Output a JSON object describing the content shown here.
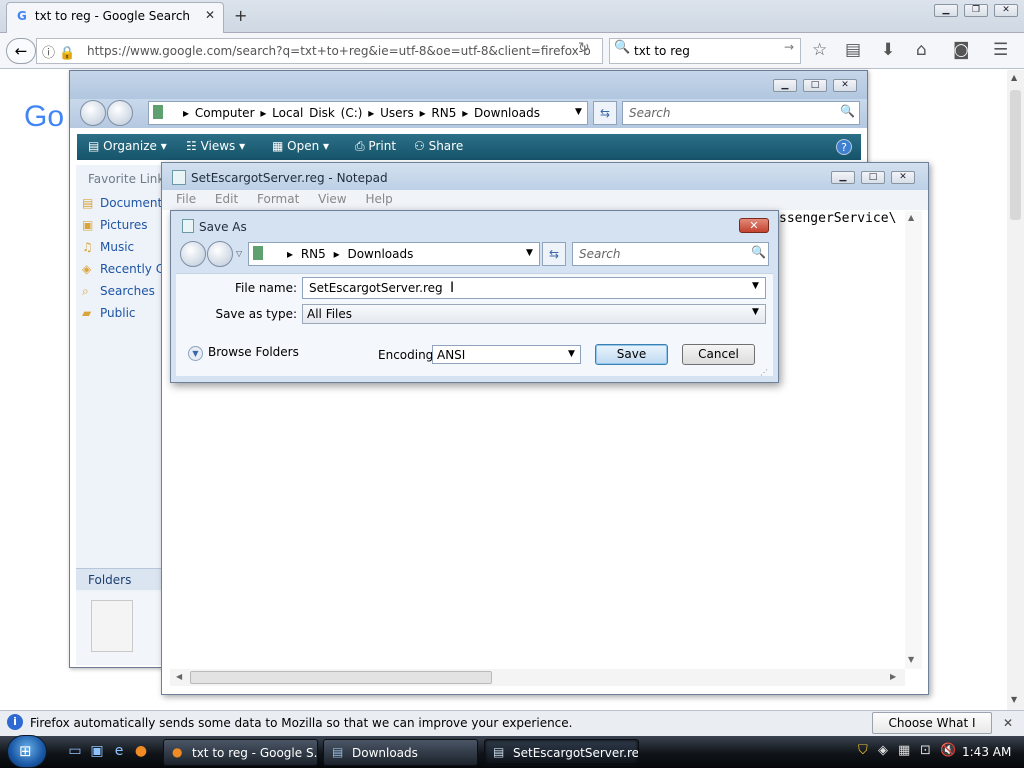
{
  "firefox": {
    "tab_title": "txt to reg - Google Search",
    "url": "https://www.google.com/search?q=txt+to+reg&ie=utf-8&oe=utf-8&client=firefox-b",
    "search_value": "txt to reg",
    "notification_text": "Firefox automatically sends some data to Mozilla so that we can improve your experience.",
    "notification_button": "Choose What I Share"
  },
  "page": {
    "google_logo": "Go"
  },
  "explorer": {
    "breadcrumbs": [
      "Computer",
      "Local Disk (C:)",
      "Users",
      "RN5",
      "Downloads"
    ],
    "search_placeholder": "Search",
    "toolbar": [
      "Organize",
      "Views",
      "Open",
      "Print",
      "Share"
    ],
    "favorite_links_title": "Favorite Links",
    "favorite_links": [
      "Documents",
      "Pictures",
      "Music",
      "Recently Changed",
      "Searches",
      "Public"
    ],
    "folders_label": "Folders"
  },
  "notepad": {
    "title": "SetEscargotServer.reg - Notepad",
    "menu": [
      "File",
      "Edit",
      "Format",
      "View",
      "Help"
    ],
    "visible_text": "ssengerService\\"
  },
  "save_as": {
    "title": "Save As",
    "breadcrumbs": [
      "RN5",
      "Downloads"
    ],
    "search_placeholder": "Search",
    "file_name_label": "File name:",
    "file_name_value": "SetEscargotServer.reg",
    "save_as_type_label": "Save as type:",
    "save_as_type_value": "All Files",
    "browse_folders": "Browse Folders",
    "encoding_label": "Encoding:",
    "encoding_value": "ANSI",
    "save_label": "Save",
    "cancel_label": "Cancel"
  },
  "taskbar": {
    "tasks": [
      "txt to reg - Google S...",
      "Downloads",
      "SetEscargotServer.re..."
    ],
    "clock": "1:43 AM"
  },
  "colors": {
    "explorer_toolbar": "#16546b",
    "firefox_tabbar": "#dce3ec",
    "taskbar": "#101418",
    "save_button_border": "#3c7fb1"
  }
}
